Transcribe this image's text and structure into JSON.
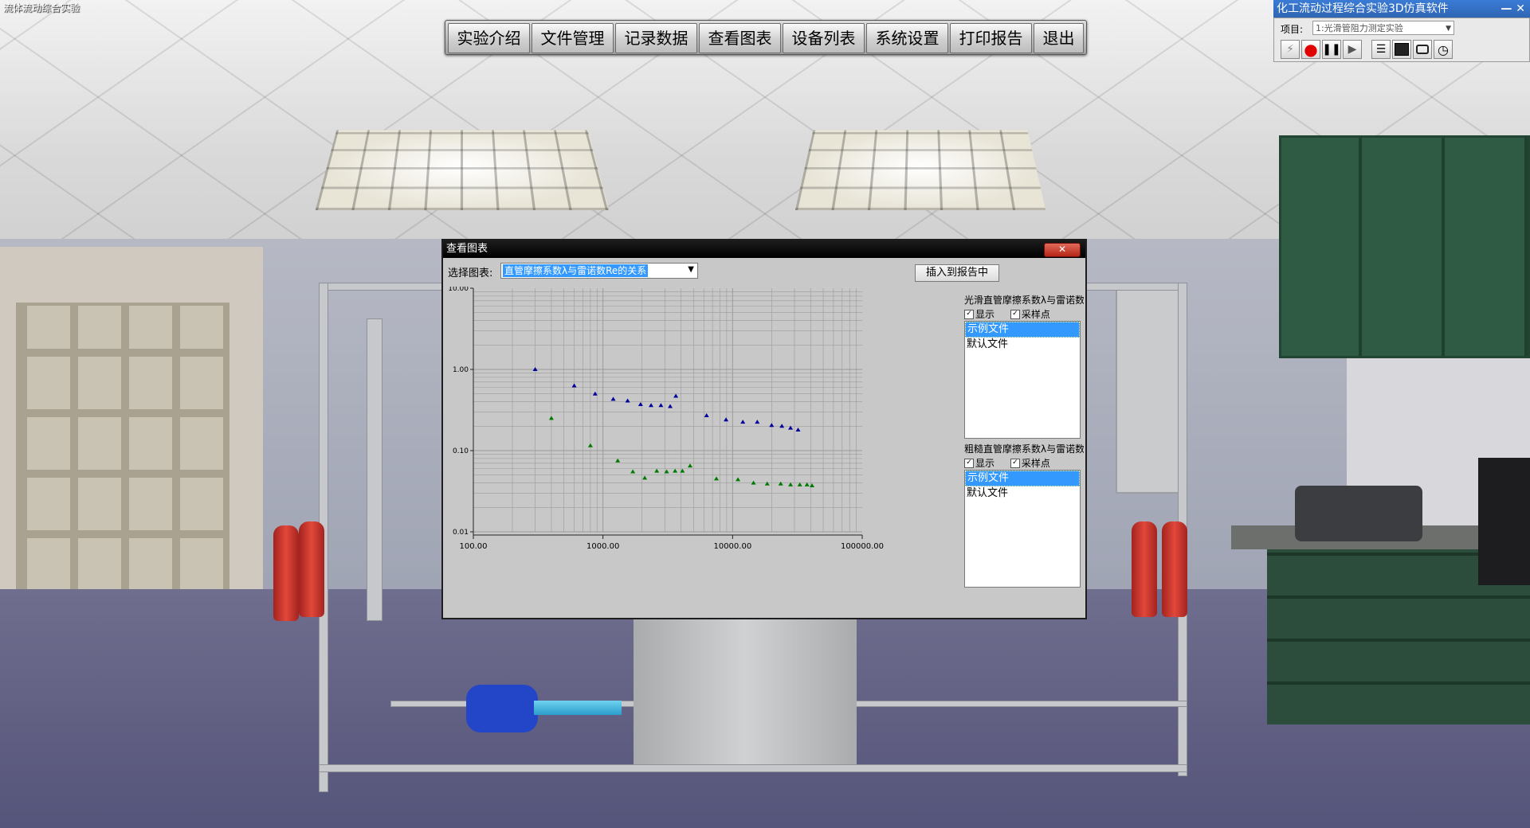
{
  "app": {
    "title": "流体流动综合实验",
    "side_title": "化工流动过程综合实验3D仿真软件",
    "window_controls": "— ✕"
  },
  "top_menu": {
    "items": [
      "实验介绍",
      "文件管理",
      "记录数据",
      "查看图表",
      "设备列表",
      "系统设置",
      "打印报告",
      "退出"
    ]
  },
  "side_panel": {
    "project_label": "项目:",
    "project_value": "1:光滑管阻力测定实验",
    "tools": [
      {
        "name": "flash-icon",
        "glyph": "⚡"
      },
      {
        "name": "record-icon",
        "glyph": "●"
      },
      {
        "name": "pause-icon",
        "glyph": "❚❚"
      },
      {
        "name": "play-icon",
        "glyph": "▶"
      },
      {
        "name": "list-icon",
        "glyph": "☰"
      },
      {
        "name": "chart-icon",
        "glyph": "📈"
      },
      {
        "name": "camera-icon",
        "glyph": "📷"
      },
      {
        "name": "clock-icon",
        "glyph": "◷"
      }
    ]
  },
  "dialog": {
    "title": "查看图表",
    "close_label": "✕",
    "select_label": "选择图表:",
    "selected_chart": "直管摩擦系数λ与雷诺数Re的关系",
    "insert_button": "插入到报告中",
    "legends": [
      {
        "title": "光滑直管摩擦系数λ与雷诺数",
        "show_label": "显示",
        "points_label": "采样点",
        "show_checked": true,
        "points_checked": true,
        "files": [
          "示例文件",
          "默认文件"
        ],
        "selected_index": 0
      },
      {
        "title": "粗糙直管摩擦系数λ与雷诺数",
        "show_label": "显示",
        "points_label": "采样点",
        "show_checked": true,
        "points_checked": true,
        "files": [
          "示例文件",
          "默认文件"
        ],
        "selected_index": 0
      }
    ]
  },
  "colors": {
    "plot_bg": "#c8c8c8",
    "grid": "#9a9a9a",
    "series_smooth": "#00009c",
    "series_rough": "#007a00",
    "selection": "#3399ff"
  },
  "chart_data": {
    "type": "scatter",
    "x_scale": "log",
    "y_scale": "log",
    "xlim": [
      100,
      100000
    ],
    "ylim": [
      0.01,
      10
    ],
    "x_ticks": [
      "100.00",
      "1000.00",
      "10000.00",
      "100000.00"
    ],
    "y_ticks": [
      "10.00",
      "1.00",
      "0.10",
      "0.01"
    ],
    "grid": true,
    "series": [
      {
        "marker": "triangle",
        "color": "#00009c",
        "x": [
          300,
          600,
          870,
          1200,
          1550,
          1950,
          2350,
          2800,
          3300,
          3650,
          6300,
          8900,
          12000,
          15500,
          20000,
          24000,
          28000,
          32000
        ],
        "y": [
          1.0,
          0.63,
          0.5,
          0.43,
          0.41,
          0.37,
          0.36,
          0.36,
          0.35,
          0.47,
          0.27,
          0.24,
          0.225,
          0.225,
          0.205,
          0.2,
          0.19,
          0.18
        ]
      },
      {
        "marker": "triangle",
        "color": "#007a00",
        "x": [
          400,
          800,
          1300,
          1700,
          2100,
          2600,
          3100,
          3600,
          4100,
          4700,
          7500,
          11000,
          14500,
          18500,
          23500,
          28000,
          33000,
          37500,
          41000
        ],
        "y": [
          0.25,
          0.115,
          0.075,
          0.055,
          0.046,
          0.056,
          0.055,
          0.056,
          0.056,
          0.065,
          0.045,
          0.044,
          0.04,
          0.039,
          0.039,
          0.038,
          0.038,
          0.038,
          0.037
        ]
      }
    ]
  }
}
